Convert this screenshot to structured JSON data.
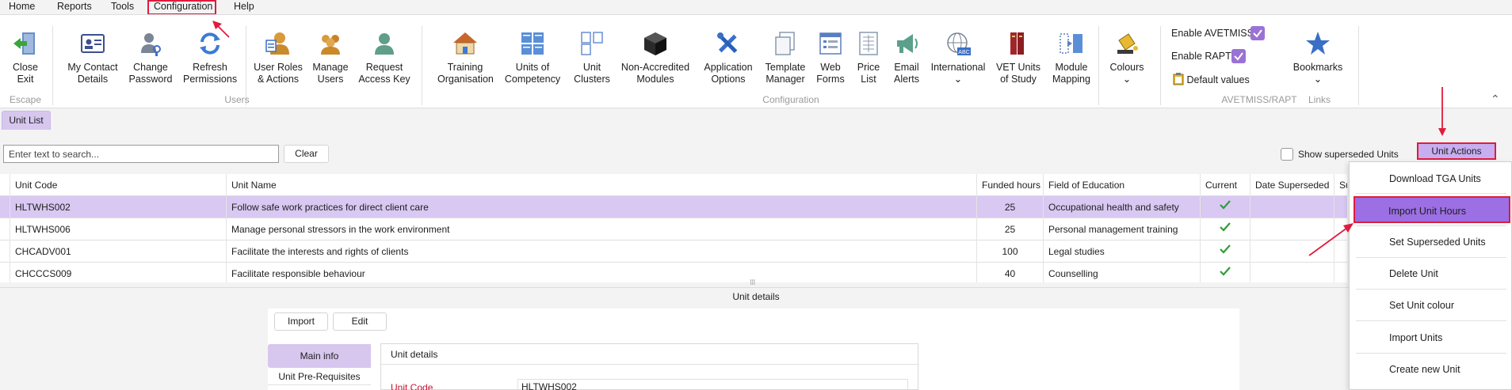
{
  "menu": {
    "items": [
      "Home",
      "Reports",
      "Tools",
      "Configuration",
      "Help"
    ]
  },
  "ribbon": {
    "buttons": {
      "close_exit": "Close\nExit",
      "my_contact_details": "My Contact\nDetails",
      "change_password": "Change\nPassword",
      "refresh_permissions": "Refresh\nPermissions",
      "user_roles_actions": "User Roles\n& Actions",
      "manage_users": "Manage\nUsers",
      "request_access_key": "Request\nAccess Key",
      "training_organisation": "Training\nOrganisation",
      "units_of_competency": "Units of\nCompetency",
      "unit_clusters": "Unit\nClusters",
      "non_accredited_modules": "Non-Accredited\nModules",
      "application_options": "Application\nOptions",
      "template_manager": "Template\nManager",
      "web_forms": "Web\nForms",
      "price_list": "Price\nList",
      "email_alerts": "Email\nAlerts",
      "international": "International",
      "vet_units_of_study": "VET Units\nof Study",
      "module_mapping": "Module\nMapping",
      "colours": "Colours",
      "bookmarks": "Bookmarks"
    },
    "groups": {
      "escape": "Escape",
      "users": "Users",
      "configuration": "Configuration",
      "avetmiss_rapt": "AVETMISS/RAPT",
      "links": "Links"
    },
    "avetmiss": {
      "enable_avetmiss": "Enable AVETMISS",
      "enable_avetmiss_checked": true,
      "enable_rapt": "Enable RAPT",
      "enable_rapt_checked": true,
      "default_values": "Default values"
    }
  },
  "tabs": {
    "unit_list": "Unit List"
  },
  "toolbar": {
    "search_placeholder": "Enter text to search...",
    "clear": "Clear",
    "show_superseded": "Show superseded Units",
    "show_superseded_checked": false,
    "unit_actions": "Unit Actions"
  },
  "grid": {
    "columns": [
      "Unit Code",
      "Unit Name",
      "Funded hours",
      "Field of Education",
      "Current",
      "Date Superseded",
      "Su"
    ],
    "rows": [
      {
        "code": "HLTWHS002",
        "name": "Follow safe work practices for direct client care",
        "hours": "25",
        "field": "Occupational health and safety",
        "current": true,
        "selected": true
      },
      {
        "code": "HLTWHS006",
        "name": "Manage personal stressors in the work environment",
        "hours": "25",
        "field": "Personal management training",
        "current": true,
        "selected": false
      },
      {
        "code": "CHCADV001",
        "name": "Facilitate the interests and rights of clients",
        "hours": "100",
        "field": "Legal studies",
        "current": true,
        "selected": false
      },
      {
        "code": "CHCCCS009",
        "name": "Facilitate responsible behaviour",
        "hours": "40",
        "field": "Counselling",
        "current": true,
        "selected": false
      }
    ]
  },
  "details": {
    "bar_title": "Unit details",
    "import": "Import",
    "edit": "Edit",
    "tab_main_info": "Main info",
    "tab_prerequisites": "Unit Pre-Requisites",
    "section_title": "Unit details",
    "unit_code_label": "Unit Code",
    "unit_code_value": "HLTWHS002"
  },
  "dropdown": {
    "items": [
      "Download TGA Units",
      "Import Unit Hours",
      "Set Superseded Units",
      "Delete Unit",
      "Set Unit colour",
      "Import Units",
      "Create new Unit"
    ],
    "highlighted": "Import Unit Hours"
  },
  "colors": {
    "accent": "#9c6fe4",
    "selection": "#d8c8f2",
    "annotation": "#e01b3c",
    "check": "#2e9e3a"
  }
}
